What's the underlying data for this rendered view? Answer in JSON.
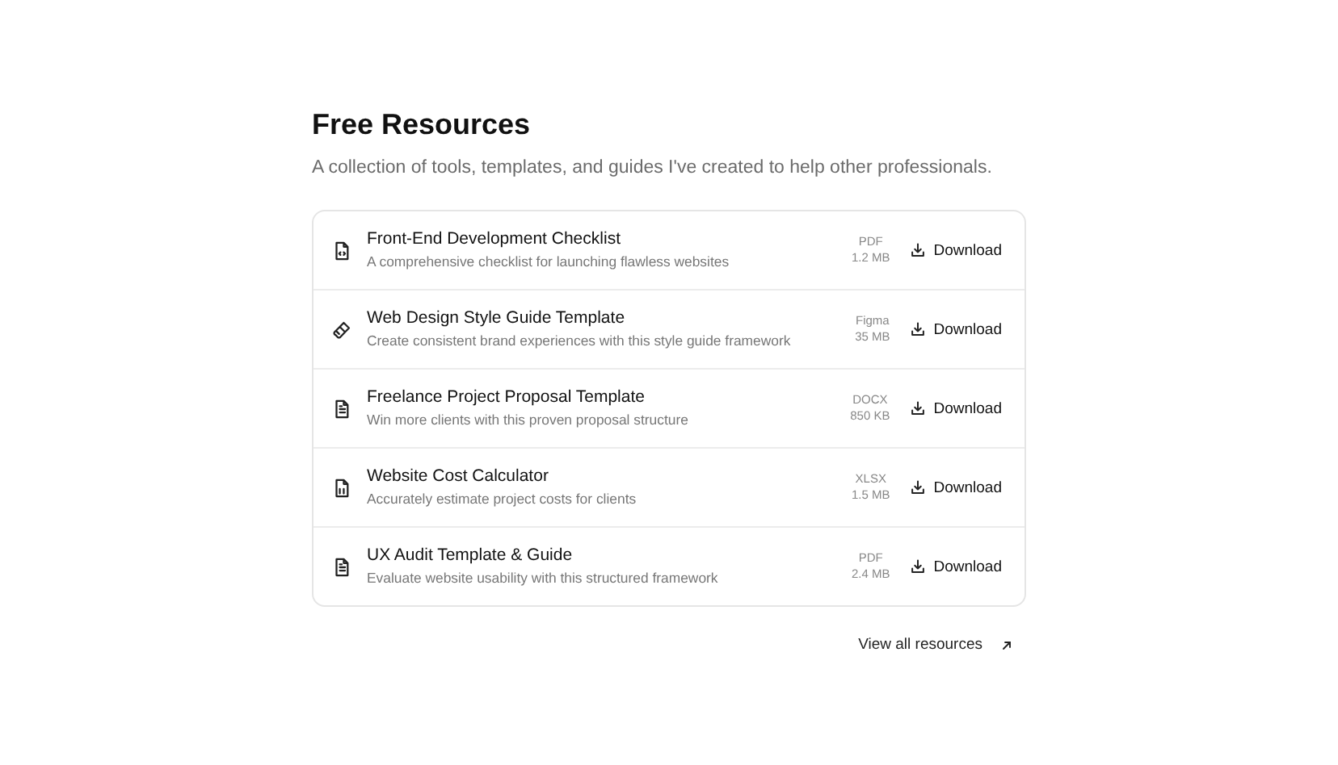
{
  "heading": "Free Resources",
  "subtitle": "A collection of tools, templates, and guides I've created to help other professionals.",
  "resources": [
    {
      "kind": "code",
      "title": "Front-End Development Checklist",
      "description": "A comprehensive checklist for launching flawless websites",
      "format": "PDF",
      "size": "1.2 MB",
      "action": "Download"
    },
    {
      "kind": "brush",
      "title": "Web Design Style Guide Template",
      "description": "Create consistent brand experiences with this style guide framework",
      "format": "Figma",
      "size": "35 MB",
      "action": "Download"
    },
    {
      "kind": "text",
      "title": "Freelance Project Proposal Template",
      "description": "Win more clients with this proven proposal structure",
      "format": "DOCX",
      "size": "850 KB",
      "action": "Download"
    },
    {
      "kind": "sheet",
      "title": "Website Cost Calculator",
      "description": "Accurately estimate project costs for clients",
      "format": "XLSX",
      "size": "1.5 MB",
      "action": "Download"
    },
    {
      "kind": "text",
      "title": "UX Audit Template & Guide",
      "description": "Evaluate website usability with this structured framework",
      "format": "PDF",
      "size": "2.4 MB",
      "action": "Download"
    }
  ],
  "footer_link": "View all resources"
}
